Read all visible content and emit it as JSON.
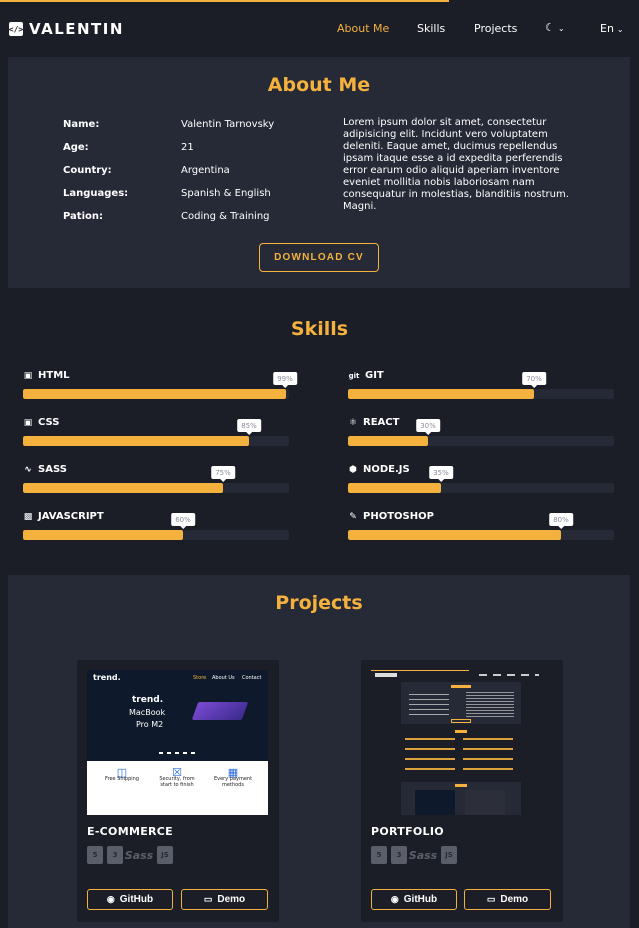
{
  "header": {
    "brand_icon": "</>",
    "brand": "VALENTIN",
    "nav": [
      "About Me",
      "Skills",
      "Projects"
    ],
    "theme_icon": "moon-icon",
    "lang": "En"
  },
  "about": {
    "title": "About Me",
    "info": [
      {
        "label": "Name:",
        "value": "Valentin Tarnovsky"
      },
      {
        "label": "Age:",
        "value": "21"
      },
      {
        "label": "Country:",
        "value": "Argentina"
      },
      {
        "label": "Languages:",
        "value": "Spanish & English"
      },
      {
        "label": "Pation:",
        "value": "Coding & Training"
      }
    ],
    "text": "Lorem ipsum dolor sit amet, consectetur adipisicing elit. Incidunt vero voluptatem deleniti. Eaque amet, ducimus repellendus ipsam itaque esse a id expedita perferendis error earum odio aliquid aperiam inventore eveniet mollitia nobis laboriosam nam consequatur in molestias, blanditiis nostrum. Magni.",
    "cv_button": "DOWNLOAD CV"
  },
  "skills": {
    "title": "Skills",
    "items": [
      {
        "name": "HTML",
        "percent": 99,
        "label": "99%",
        "icon": "html5-icon"
      },
      {
        "name": "GIT",
        "percent": 70,
        "label": "70%",
        "icon": "git-icon"
      },
      {
        "name": "CSS",
        "percent": 85,
        "label": "85%",
        "icon": "css3-icon"
      },
      {
        "name": "REACT",
        "percent": 30,
        "label": "30%",
        "icon": "react-icon"
      },
      {
        "name": "SASS",
        "percent": 75,
        "label": "75%",
        "icon": "sass-icon"
      },
      {
        "name": "NODE.JS",
        "percent": 35,
        "label": "35%",
        "icon": "nodejs-icon"
      },
      {
        "name": "JAVASCRIPT",
        "percent": 60,
        "label": "60%",
        "icon": "javascript-icon"
      },
      {
        "name": "PHOTOSHOP",
        "percent": 80,
        "label": "80%",
        "icon": "photoshop-icon"
      }
    ]
  },
  "projects": {
    "title": "Projects",
    "cards": [
      {
        "title": "E-COMMERCE",
        "tech": [
          "html5-icon",
          "css3-icon",
          "sass-icon",
          "js-icon"
        ],
        "github": "GitHub",
        "demo": "Demo",
        "preview": {
          "logo": "trend.",
          "nav": [
            "Store",
            "About Us",
            "Contact"
          ],
          "hero_logo": "trend.",
          "hero_line1": "MacBook",
          "hero_line2": "Pro M2",
          "features": [
            "Free Shipping",
            "Security, from start to finish",
            "Every payment methods"
          ]
        }
      },
      {
        "title": "PORTFOLIO",
        "tech": [
          "html5-icon",
          "css3-icon",
          "sass-icon",
          "js-icon"
        ],
        "github": "GitHub",
        "demo": "Demo"
      }
    ]
  },
  "colors": {
    "accent": "#f4b13e",
    "background": "#1b1e27",
    "panel": "#262a36"
  }
}
